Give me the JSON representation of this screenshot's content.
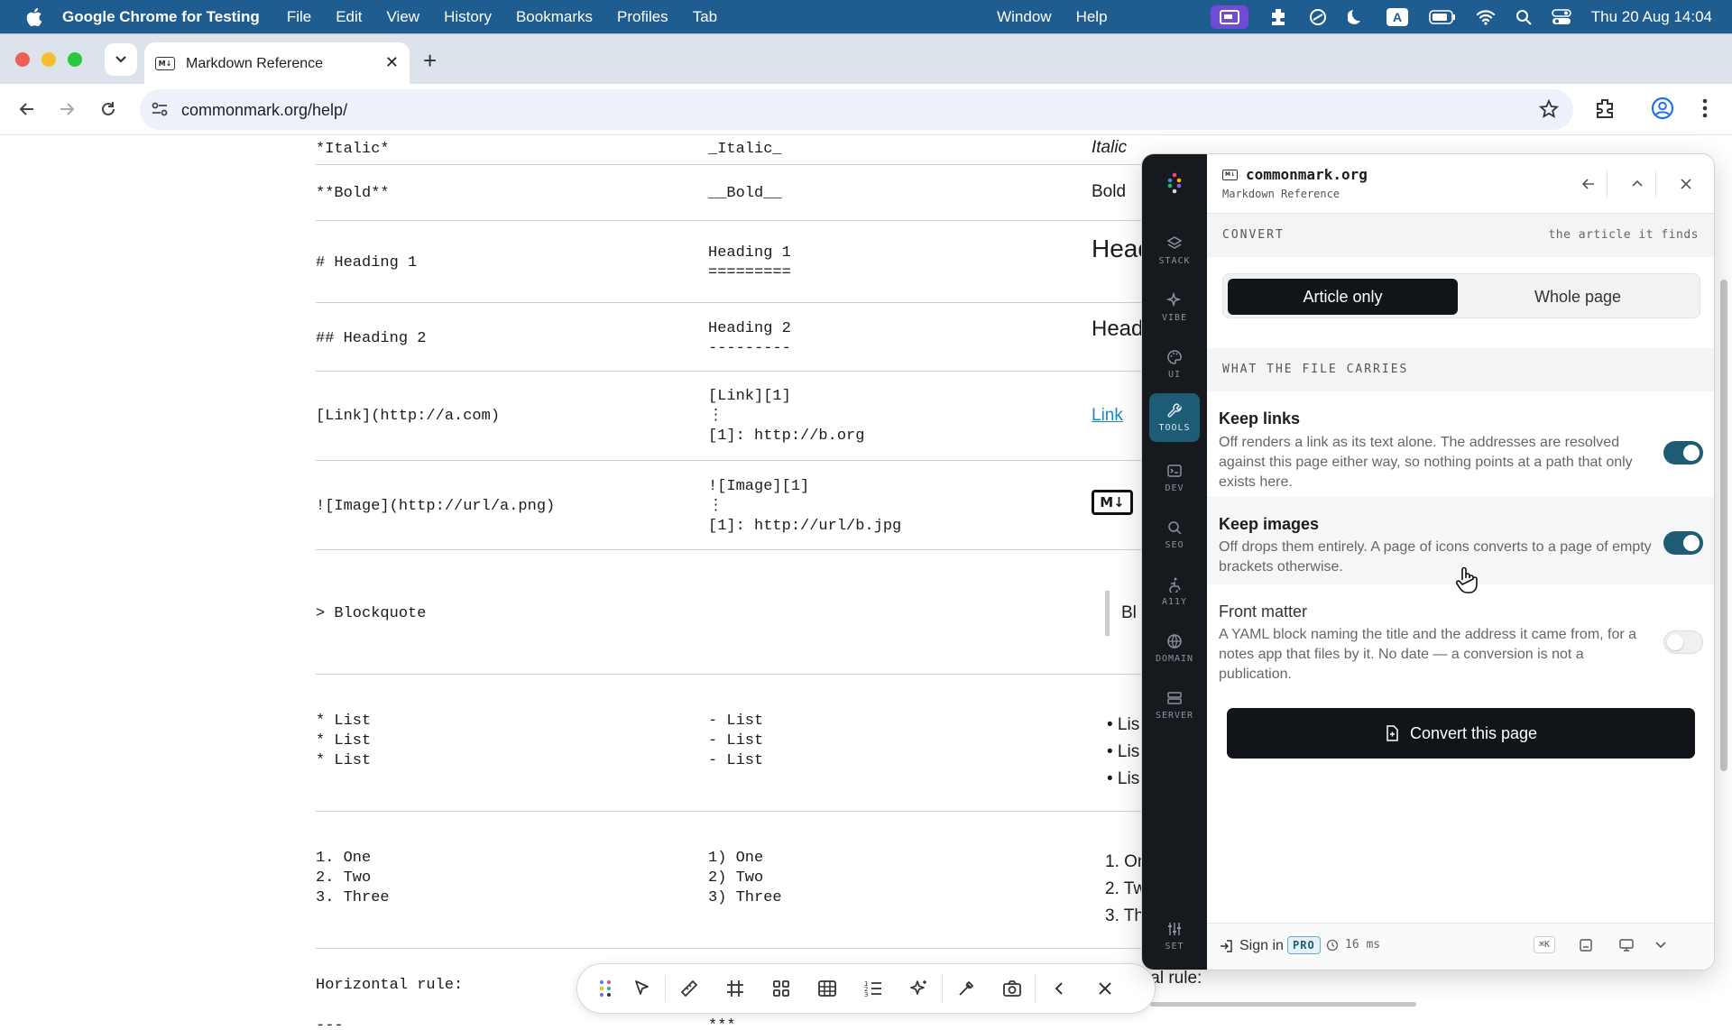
{
  "menubar": {
    "app_name": "Google Chrome for Testing",
    "items": [
      "File",
      "Edit",
      "View",
      "History",
      "Bookmarks",
      "Profiles",
      "Tab"
    ],
    "right_items": [
      "Window",
      "Help"
    ],
    "clock": "Thu 20 Aug  14:04"
  },
  "browser": {
    "tab_title": "Markdown Reference",
    "url": "commonmark.org/help/"
  },
  "table": {
    "rows": [
      {
        "syntax": "*Italic*",
        "alt": "_Italic_",
        "rendered": "Italic"
      },
      {
        "syntax": "**Bold**",
        "alt": "__Bold__",
        "rendered": "Bold"
      },
      {
        "syntax": "# Heading 1",
        "alt": "Heading 1\n=========",
        "rendered": "Head"
      },
      {
        "syntax": "## Heading 2",
        "alt": "Heading 2\n---------",
        "rendered": "Head"
      },
      {
        "syntax": "[Link](http://a.com)",
        "alt": "[Link][1]\n⋮\n[1]: http://b.org",
        "rendered": "Link"
      },
      {
        "syntax": "![Image](http://url/a.png)",
        "alt": "![Image][1]\n⋮\n[1]: http://url/b.jpg",
        "rendered": "M↓"
      },
      {
        "syntax": "> Blockquote",
        "alt": "",
        "rendered": "Bl"
      },
      {
        "syntax": "* List\n* List\n* List",
        "alt": "- List\n- List\n- List",
        "rendered": "• Lis\n• Lis\n• Lis"
      },
      {
        "syntax": "1. One\n2. Two\n3. Three",
        "alt": "1) One\n2) Two\n3) Three",
        "rendered": "1. On\n2. Tw\n3. Th"
      },
      {
        "syntax": "Horizontal rule:",
        "alt": "",
        "rendered": "tal rule:"
      },
      {
        "syntax": "---",
        "alt": "***",
        "rendered": ""
      }
    ]
  },
  "panel": {
    "domain": "commonmark.org",
    "subtitle": "Markdown Reference",
    "rail": [
      "STACK",
      "VIBE",
      "UI",
      "TOOLS",
      "DEV",
      "SEO",
      "A11Y",
      "DOMAIN",
      "SERVER",
      "SET"
    ],
    "active_rail": "TOOLS",
    "convert_label": "CONVERT",
    "convert_hint": "the article it finds",
    "scope": {
      "selected": "Article only",
      "other": "Whole page"
    },
    "file_section": "WHAT THE FILE CARRIES",
    "options": [
      {
        "title": "Keep links",
        "desc": "Off renders a link as its text alone. The addresses are resolved against this page either way, so nothing points at a path that only exists here.",
        "on": true
      },
      {
        "title": "Keep images",
        "desc": "Off drops them entirely. A page of icons converts to a page of empty brackets otherwise.",
        "on": true
      },
      {
        "title": "Front matter",
        "desc": "A YAML block naming the title and the address it came from, for a notes app that files by it. No date — a conversion is not a publication.",
        "on": false
      }
    ],
    "convert_button": "Convert this page",
    "footer": {
      "sign_in": "Sign in",
      "pro": "PRO",
      "latency": "16 ms",
      "shortcut": "⌘K"
    }
  },
  "colors": {
    "accent": "#1e5b74",
    "menubar": "#1f5c8f",
    "dark": "#111418"
  }
}
